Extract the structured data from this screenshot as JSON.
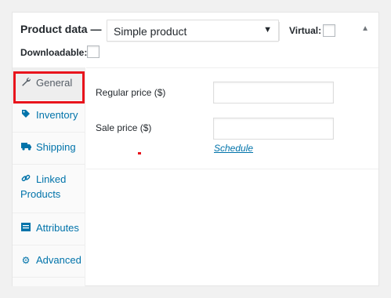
{
  "header": {
    "title": "Product data —",
    "product_type": "Simple product",
    "virtual_label": "Virtual:",
    "downloadable_label": "Downloadable:",
    "toggle_icon": "triangle-up-icon"
  },
  "tabs": [
    {
      "label": "General",
      "icon": "wrench-icon",
      "active": true
    },
    {
      "label": "Inventory",
      "icon": "tag-icon"
    },
    {
      "label": "Shipping",
      "icon": "truck-icon"
    },
    {
      "label_line1": "Linked",
      "label_line2": "Products",
      "icon": "link-icon"
    },
    {
      "label": "Attributes",
      "icon": "list-icon"
    },
    {
      "label": "Advanced",
      "icon": "gear-icon"
    }
  ],
  "general": {
    "regular_price_label": "Regular price ($)",
    "sale_price_label": "Sale price ($)",
    "regular_price_value": "",
    "sale_price_value": "",
    "schedule_link": "Schedule"
  },
  "colors": {
    "accent": "#0073aa",
    "highlight": "#e8141c"
  }
}
